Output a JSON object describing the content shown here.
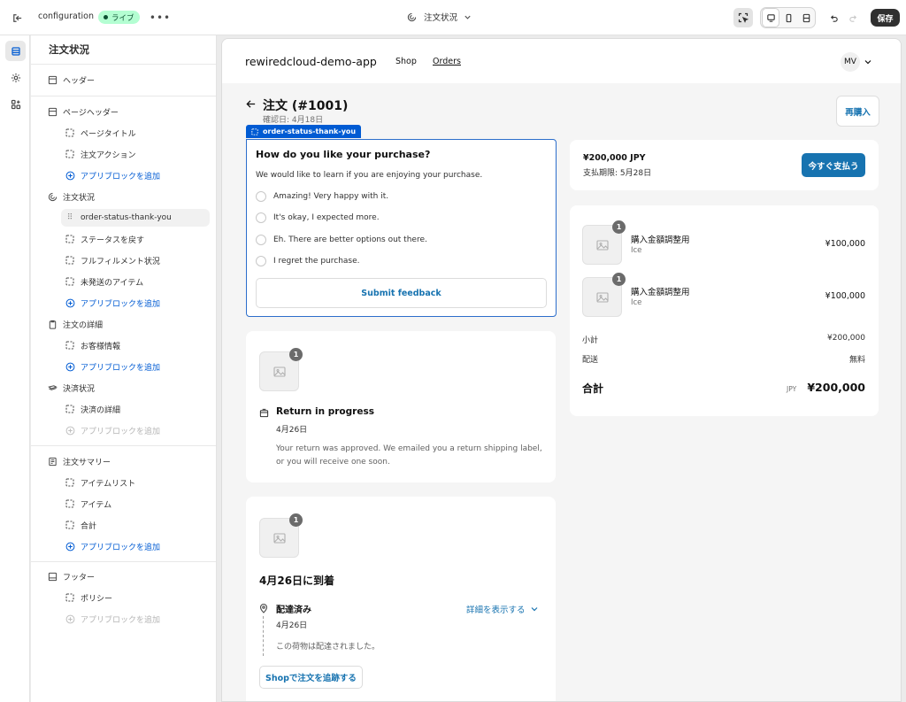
{
  "topbar": {
    "app_name": "configuration",
    "status_badge": "ライブ",
    "page_select": "注文状況",
    "save_label": "保存"
  },
  "sidebar": {
    "title": "注文状況",
    "header_section": "ヘッダー",
    "page_header_section": "ページヘッダー",
    "page_title_item": "ページタイトル",
    "order_actions_item": "注文アクション",
    "add_app_block": "アプリブロックを追加",
    "order_status_section": "注文状況",
    "order_status_thank_you": "order-status-thank-you",
    "return_status": "ステータスを戻す",
    "fulfillment_status": "フルフィルメント状況",
    "unfulfilled_items": "未発送のアイテム",
    "order_details_section": "注文の詳細",
    "customer_info": "お客様情報",
    "payment_status_section": "決済状況",
    "payment_details": "決済の詳細",
    "order_summary_section": "注文サマリー",
    "item_list": "アイテムリスト",
    "item": "アイテム",
    "total": "合計",
    "footer_section": "フッター",
    "policy": "ポリシー"
  },
  "shop": {
    "name": "rewiredcloud-demo-app",
    "nav_shop": "Shop",
    "nav_orders": "Orders",
    "avatar": "MV"
  },
  "order": {
    "title": "注文 (#1001)",
    "confirmed": "確認日: 4月18日",
    "reorder": "再購入"
  },
  "feedback": {
    "block_tag": "order-status-thank-you",
    "question": "How do you like your purchase?",
    "intro": "We would like to learn if you are enjoying your purchase.",
    "options": [
      "Amazing! Very happy with it.",
      "It's okay, I expected more.",
      "Eh. There are better options out there.",
      "I regret the purchase."
    ],
    "submit": "Submit feedback"
  },
  "return_card": {
    "qty": "1",
    "title": "Return in progress",
    "date": "4月26日",
    "line1": "Your return was approved. We emailed you a return shipping label,",
    "line2": "or you will receive one soon."
  },
  "delivery_card": {
    "qty": "1",
    "title": "4月26日に到着",
    "status": "配達済み",
    "details_link": "詳細を表示する",
    "date": "4月26日",
    "message": "この荷物は配達されました。",
    "track_button": "Shopで注文を追跡する"
  },
  "payment_card": {
    "amount": "¥200,000 JPY",
    "due": "支払期限: 5月28日",
    "pay_button": "今すぐ支払う"
  },
  "summary": {
    "items": [
      {
        "qty": "1",
        "name": "購入金額調整用",
        "variant": "Ice",
        "price": "¥100,000"
      },
      {
        "qty": "1",
        "name": "購入金額調整用",
        "variant": "Ice",
        "price": "¥100,000"
      }
    ],
    "subtotal_label": "小計",
    "subtotal_value": "¥200,000",
    "shipping_label": "配送",
    "shipping_value": "無料",
    "total_label": "合計",
    "currency": "JPY",
    "total_value": "¥200,000"
  },
  "colors": {
    "accent": "#005bd3",
    "button_primary": "#1773b0",
    "live_badge_bg": "#b4fed2",
    "save_bg": "#303030"
  }
}
